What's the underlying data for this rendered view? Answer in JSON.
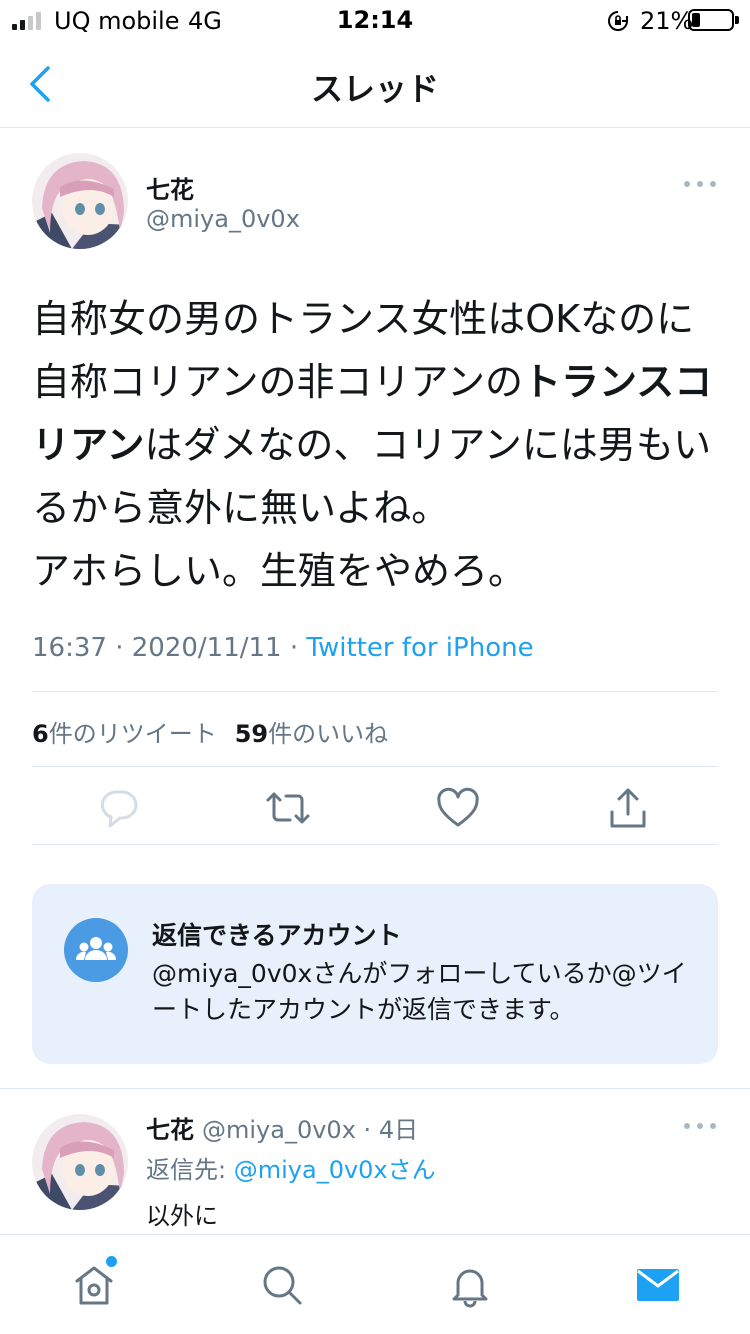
{
  "status_bar": {
    "carrier": "UQ mobile",
    "network": "4G",
    "time": "12:14",
    "battery_percent": "21%",
    "battery_level": 0.21,
    "signal_bars": 2
  },
  "nav": {
    "title": "スレッド",
    "back_icon": "chevron-left-icon"
  },
  "tweet": {
    "display_name": "七花",
    "handle": "@miya_0v0x",
    "text_segments": [
      {
        "text": "自称女の男のトランス女性はOKなのに自称コリアンの非コリアンの",
        "bold": false
      },
      {
        "text": "トランスコリアン",
        "bold": true
      },
      {
        "text": "はダメなの、コリアンには男もいるから意外に無いよね。",
        "bold": false
      },
      {
        "text": "アホらしい。生殖をやめろ。",
        "bold": false
      }
    ],
    "time": "16:37",
    "date": "2020/11/11",
    "separator": "·",
    "source": "Twitter for iPhone",
    "retweet_count": "6",
    "retweet_label": "件のリツイート",
    "like_count": "59",
    "like_label": "件のいいね",
    "actions": [
      "reply-icon",
      "retweet-icon",
      "like-icon",
      "share-icon"
    ]
  },
  "reply_restriction": {
    "icon": "people-icon",
    "title": "返信できるアカウント",
    "body": "@miya_0v0xさんがフォローしているか@ツイートしたアカウントが返信できます。"
  },
  "reply": {
    "display_name": "七花",
    "handle": "@miya_0v0x",
    "age": "4日",
    "separator": "·",
    "reply_prefix": "返信先:",
    "reply_mention": "@miya_0v0xさん",
    "text": "以外に"
  },
  "tabbar": {
    "tabs": [
      "home-icon",
      "search-icon",
      "notifications-icon",
      "messages-icon"
    ],
    "active": "messages-icon"
  },
  "colors": {
    "accent": "#1da1f2",
    "secondary_text": "#657786",
    "card_background": "#e8f1fb",
    "divider": "#e1e8ed"
  }
}
